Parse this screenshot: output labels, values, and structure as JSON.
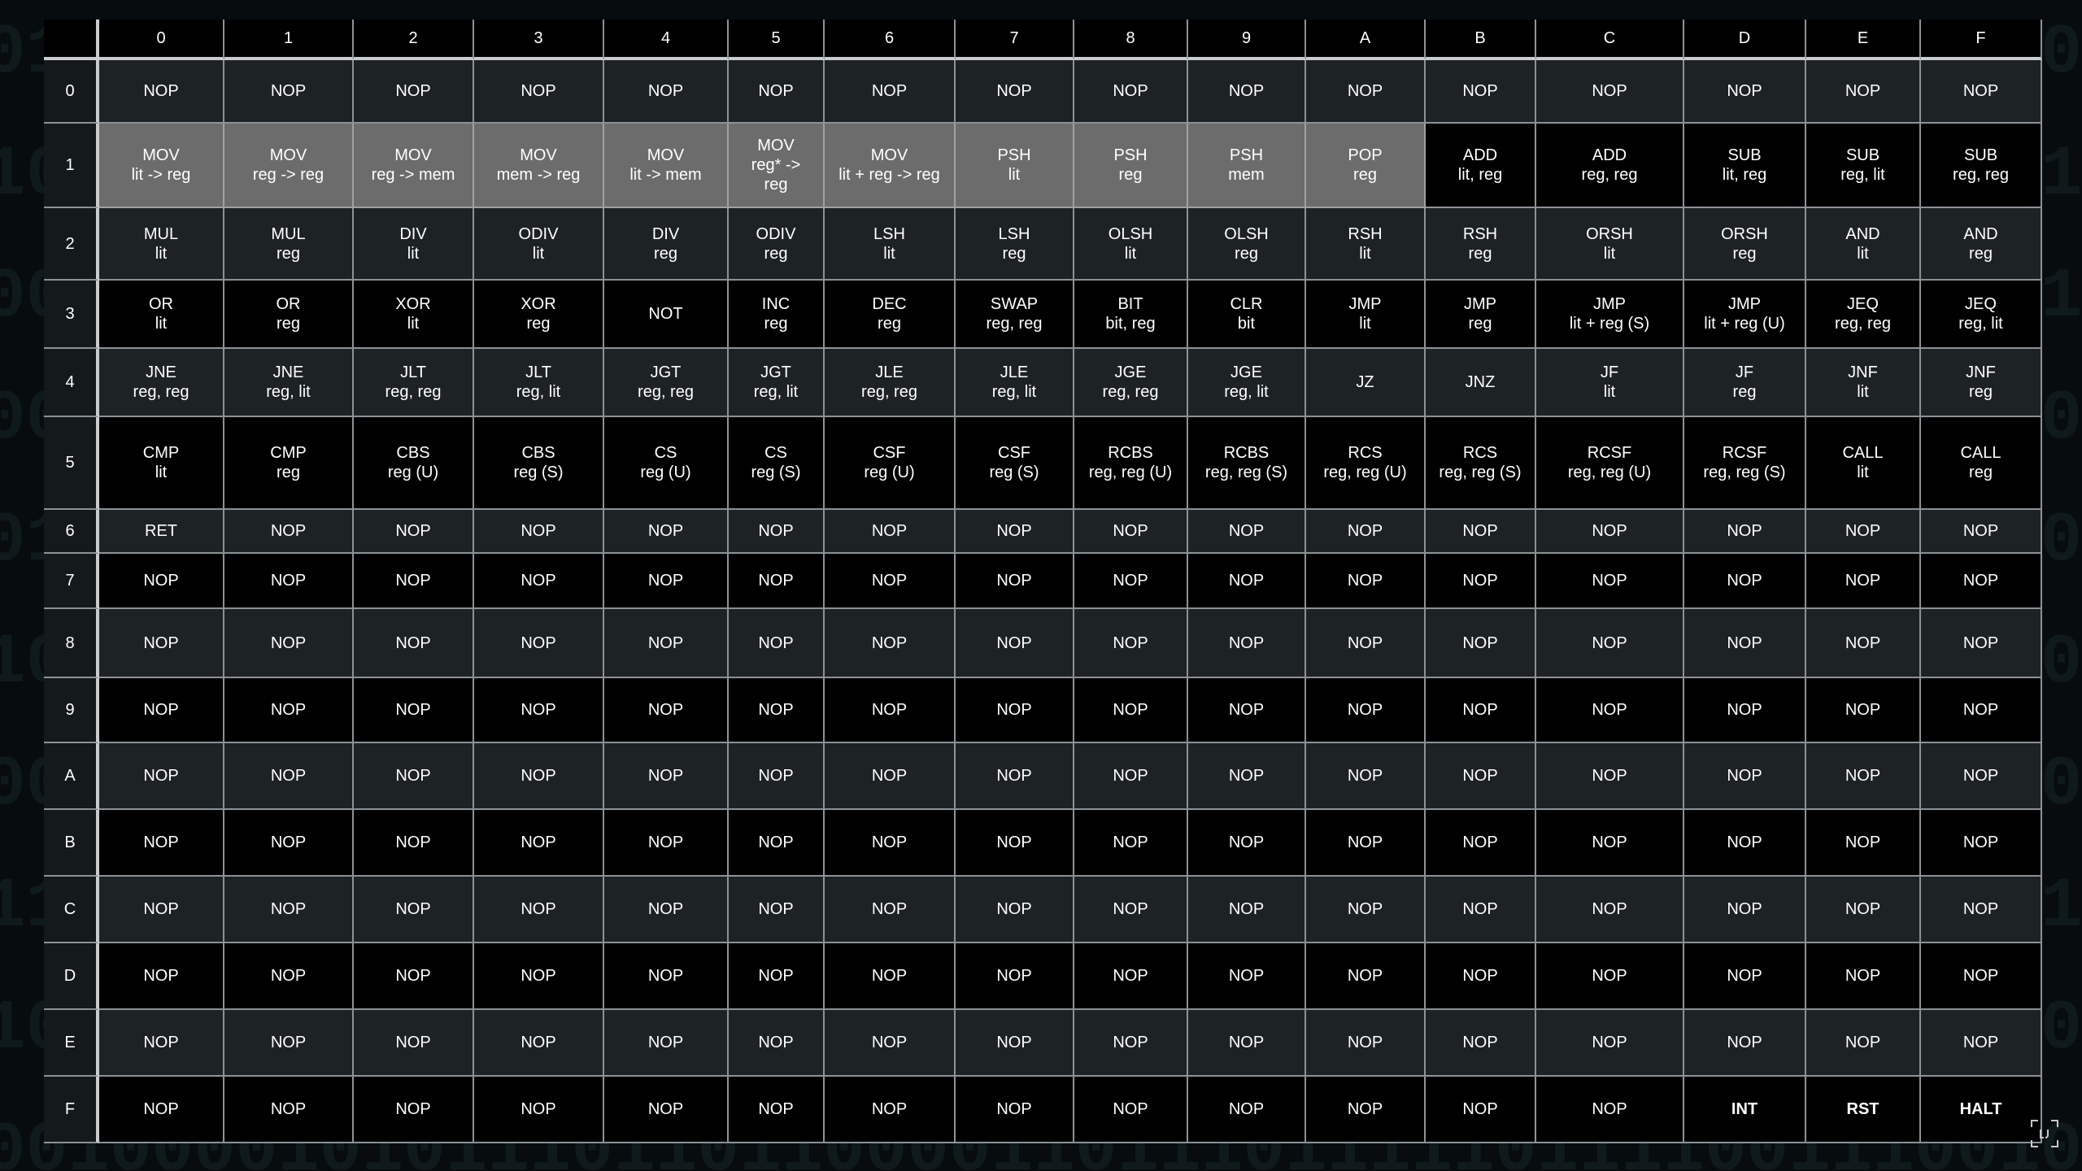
{
  "table": {
    "column_headers": [
      "0",
      "1",
      "2",
      "3",
      "4",
      "5",
      "6",
      "7",
      "8",
      "9",
      "A",
      "B",
      "C",
      "D",
      "E",
      "F"
    ],
    "rows": [
      {
        "label": "0",
        "cells": [
          "NOP",
          "NOP",
          "NOP",
          "NOP",
          "NOP",
          "NOP",
          "NOP",
          "NOP",
          "NOP",
          "NOP",
          "NOP",
          "NOP",
          "NOP",
          "NOP",
          "NOP",
          "NOP"
        ]
      },
      {
        "label": "1",
        "cells": [
          "MOV\nlit -> reg",
          "MOV\nreg -> reg",
          "MOV\nreg -> mem",
          "MOV\nmem -> reg",
          "MOV\nlit -> mem",
          "MOV\nreg* ->\nreg",
          "MOV\nlit + reg -> reg",
          "PSH\nlit",
          "PSH\nreg",
          "PSH\nmem",
          "POP\nreg",
          "ADD\nlit, reg",
          "ADD\nreg, reg",
          "SUB\nlit, reg",
          "SUB\nreg, lit",
          "SUB\nreg, reg"
        ]
      },
      {
        "label": "2",
        "cells": [
          "MUL\nlit",
          "MUL\nreg",
          "DIV\nlit",
          "ODIV\nlit",
          "DIV\nreg",
          "ODIV\nreg",
          "LSH\nlit",
          "LSH\nreg",
          "OLSH\nlit",
          "OLSH\nreg",
          "RSH\nlit",
          "RSH\nreg",
          "ORSH\nlit",
          "ORSH\nreg",
          "AND\nlit",
          "AND\nreg"
        ]
      },
      {
        "label": "3",
        "cells": [
          "OR\nlit",
          "OR\nreg",
          "XOR\nlit",
          "XOR\nreg",
          "NOT",
          "INC\nreg",
          "DEC\nreg",
          "SWAP\nreg, reg",
          "BIT\nbit, reg",
          "CLR\nbit",
          "JMP\nlit",
          "JMP\nreg",
          "JMP\nlit + reg (S)",
          "JMP\nlit + reg (U)",
          "JEQ\nreg, reg",
          "JEQ\nreg, lit"
        ]
      },
      {
        "label": "4",
        "cells": [
          "JNE\nreg, reg",
          "JNE\nreg, lit",
          "JLT\nreg, reg",
          "JLT\nreg, lit",
          "JGT\nreg, reg",
          "JGT\nreg, lit",
          "JLE\nreg, reg",
          "JLE\nreg, lit",
          "JGE\nreg, reg",
          "JGE\nreg, lit",
          "JZ",
          "JNZ",
          "JF\nlit",
          "JF\nreg",
          "JNF\nlit",
          "JNF\nreg"
        ]
      },
      {
        "label": "5",
        "cells": [
          "CMP\nlit",
          "CMP\nreg",
          "CBS\nreg (U)",
          "CBS\nreg (S)",
          "CS\nreg (U)",
          "CS\nreg (S)",
          "CSF\nreg (U)",
          "CSF\nreg (S)",
          "RCBS\nreg, reg (U)",
          "RCBS\nreg, reg (S)",
          "RCS\nreg, reg (U)",
          "RCS\nreg, reg (S)",
          "RCSF\nreg, reg (U)",
          "RCSF\nreg, reg (S)",
          "CALL\nlit",
          "CALL\nreg"
        ]
      },
      {
        "label": "6",
        "cells": [
          "RET",
          "NOP",
          "NOP",
          "NOP",
          "NOP",
          "NOP",
          "NOP",
          "NOP",
          "NOP",
          "NOP",
          "NOP",
          "NOP",
          "NOP",
          "NOP",
          "NOP",
          "NOP"
        ]
      },
      {
        "label": "7",
        "cells": [
          "NOP",
          "NOP",
          "NOP",
          "NOP",
          "NOP",
          "NOP",
          "NOP",
          "NOP",
          "NOP",
          "NOP",
          "NOP",
          "NOP",
          "NOP",
          "NOP",
          "NOP",
          "NOP"
        ]
      },
      {
        "label": "8",
        "cells": [
          "NOP",
          "NOP",
          "NOP",
          "NOP",
          "NOP",
          "NOP",
          "NOP",
          "NOP",
          "NOP",
          "NOP",
          "NOP",
          "NOP",
          "NOP",
          "NOP",
          "NOP",
          "NOP"
        ]
      },
      {
        "label": "9",
        "cells": [
          "NOP",
          "NOP",
          "NOP",
          "NOP",
          "NOP",
          "NOP",
          "NOP",
          "NOP",
          "NOP",
          "NOP",
          "NOP",
          "NOP",
          "NOP",
          "NOP",
          "NOP",
          "NOP"
        ]
      },
      {
        "label": "A",
        "cells": [
          "NOP",
          "NOP",
          "NOP",
          "NOP",
          "NOP",
          "NOP",
          "NOP",
          "NOP",
          "NOP",
          "NOP",
          "NOP",
          "NOP",
          "NOP",
          "NOP",
          "NOP",
          "NOP"
        ]
      },
      {
        "label": "B",
        "cells": [
          "NOP",
          "NOP",
          "NOP",
          "NOP",
          "NOP",
          "NOP",
          "NOP",
          "NOP",
          "NOP",
          "NOP",
          "NOP",
          "NOP",
          "NOP",
          "NOP",
          "NOP",
          "NOP"
        ]
      },
      {
        "label": "C",
        "cells": [
          "NOP",
          "NOP",
          "NOP",
          "NOP",
          "NOP",
          "NOP",
          "NOP",
          "NOP",
          "NOP",
          "NOP",
          "NOP",
          "NOP",
          "NOP",
          "NOP",
          "NOP",
          "NOP"
        ]
      },
      {
        "label": "D",
        "cells": [
          "NOP",
          "NOP",
          "NOP",
          "NOP",
          "NOP",
          "NOP",
          "NOP",
          "NOP",
          "NOP",
          "NOP",
          "NOP",
          "NOP",
          "NOP",
          "NOP",
          "NOP",
          "NOP"
        ]
      },
      {
        "label": "E",
        "cells": [
          "NOP",
          "NOP",
          "NOP",
          "NOP",
          "NOP",
          "NOP",
          "NOP",
          "NOP",
          "NOP",
          "NOP",
          "NOP",
          "NOP",
          "NOP",
          "NOP",
          "NOP",
          "NOP"
        ]
      },
      {
        "label": "F",
        "cells": [
          "NOP",
          "NOP",
          "NOP",
          "NOP",
          "NOP",
          "NOP",
          "NOP",
          "NOP",
          "NOP",
          "NOP",
          "NOP",
          "NOP",
          "NOP",
          "INT",
          "RST",
          "HALT"
        ]
      }
    ]
  },
  "colors": {
    "background": "#070c0e",
    "highlight_cell": "#6c6c6c",
    "row_stripe_dark": "#000000",
    "row_stripe_light": "#1d2225",
    "grid_line": "#8c9296",
    "text": "#ffffff"
  },
  "icons": {
    "corner_logo": "fullscreen-bracket-icon"
  }
}
